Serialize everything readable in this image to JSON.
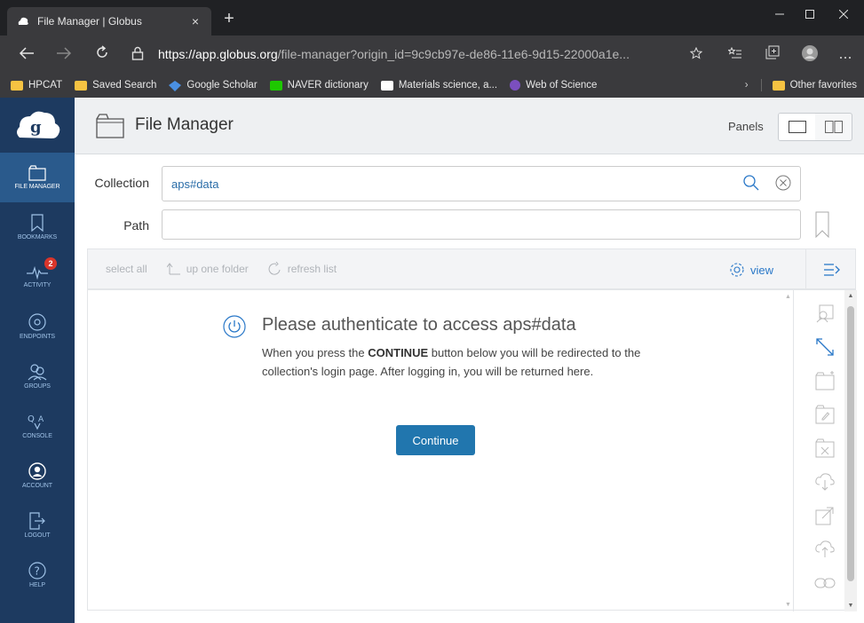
{
  "browser": {
    "tab_title": "File Manager | Globus",
    "tab_close": "×",
    "new_tab": "+",
    "url_host": "https://app.globus.org",
    "url_rest": "/file-manager?origin_id=9c9cb97e-de86-11e6-9d15-22000a1e...",
    "bookmarks": [
      {
        "label": "HPCAT",
        "icon": "folder-icon"
      },
      {
        "label": "Saved Search",
        "icon": "folder-icon"
      },
      {
        "label": "Google Scholar",
        "icon": "scholar-icon"
      },
      {
        "label": "NAVER dictionary",
        "icon": "naver-icon"
      },
      {
        "label": "Materials science, a...",
        "icon": "fe-icon"
      },
      {
        "label": "Web of Science",
        "icon": "wos-icon"
      }
    ],
    "other_favorites": "Other favorites"
  },
  "sidebar": {
    "items": [
      {
        "label": "FILE MANAGER",
        "icon": "folder-icon"
      },
      {
        "label": "BOOKMARKS",
        "icon": "bookmark-icon"
      },
      {
        "label": "ACTIVITY",
        "icon": "activity-icon",
        "badge": "2"
      },
      {
        "label": "ENDPOINTS",
        "icon": "endpoint-icon"
      },
      {
        "label": "GROUPS",
        "icon": "groups-icon"
      },
      {
        "label": "CONSOLE",
        "icon": "console-icon"
      },
      {
        "label": "ACCOUNT",
        "icon": "account-icon"
      },
      {
        "label": "LOGOUT",
        "icon": "logout-icon"
      },
      {
        "label": "HELP",
        "icon": "help-icon"
      }
    ]
  },
  "header": {
    "title": "File Manager",
    "panels_label": "Panels"
  },
  "fields": {
    "collection_label": "Collection",
    "collection_value": "aps#data",
    "path_label": "Path",
    "path_value": ""
  },
  "toolbar": {
    "select_all": "select all",
    "up_one_folder": "up one folder",
    "refresh_list": "refresh list",
    "view": "view"
  },
  "auth": {
    "title": "Please authenticate to access aps#data",
    "text_before": "When you press the ",
    "text_bold": "CONTINUE",
    "text_after": " button below you will be redirected to the collection's login page. After logging in, you will be returned here.",
    "button": "Continue"
  },
  "colors": {
    "sidebar": "#1d3a60",
    "sidebar_active": "#2a5a8c",
    "accent": "#2176ae",
    "badge": "#d9352b"
  }
}
